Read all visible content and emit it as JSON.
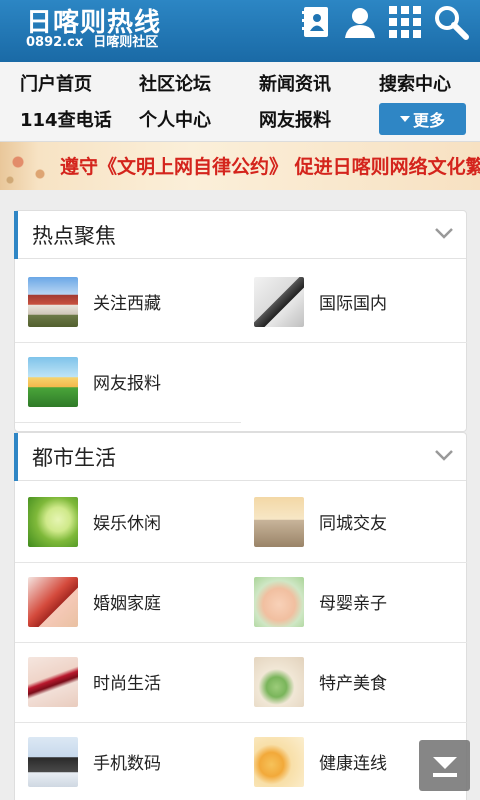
{
  "header": {
    "logo_main": "日喀则热线",
    "logo_domain": "0892.cx",
    "logo_sub": "日喀则社区",
    "icons": [
      "contact-book-icon",
      "user-icon",
      "grid-icon",
      "search-icon"
    ]
  },
  "nav": {
    "items": [
      "门户首页",
      "社区论坛",
      "新闻资讯",
      "搜索中心",
      "114查电话",
      "个人中心",
      "网友报料"
    ],
    "more_label": "更多"
  },
  "banner": {
    "text": "遵守《文明上网自律公约》 促进日喀则网络文化繁荣"
  },
  "sections": [
    {
      "title": "热点聚焦",
      "items": [
        {
          "label": "关注西藏",
          "thumb": "tibet-palace-thumb"
        },
        {
          "label": "国际国内",
          "thumb": "coffee-newspaper-thumb"
        },
        {
          "label": "网友报料",
          "thumb": "girl-sunflower-thumb"
        }
      ]
    },
    {
      "title": "都市生活",
      "items": [
        {
          "label": "娱乐休闲",
          "thumb": "green-tea-thumb"
        },
        {
          "label": "同城交友",
          "thumb": "beach-couple-thumb"
        },
        {
          "label": "婚姻家庭",
          "thumb": "wedding-couple-thumb"
        },
        {
          "label": "母婴亲子",
          "thumb": "baby-thumb"
        },
        {
          "label": "时尚生活",
          "thumb": "lipstick-thumb"
        },
        {
          "label": "特产美食",
          "thumb": "dumplings-thumb"
        },
        {
          "label": "手机数码",
          "thumb": "phones-thumb"
        },
        {
          "label": "健康连线",
          "thumb": "happy-fruit-thumb"
        }
      ]
    }
  ],
  "colors": {
    "header_blue": "#1f74b3",
    "accent_blue": "#2f86c5",
    "banner_text": "#d4241c"
  }
}
